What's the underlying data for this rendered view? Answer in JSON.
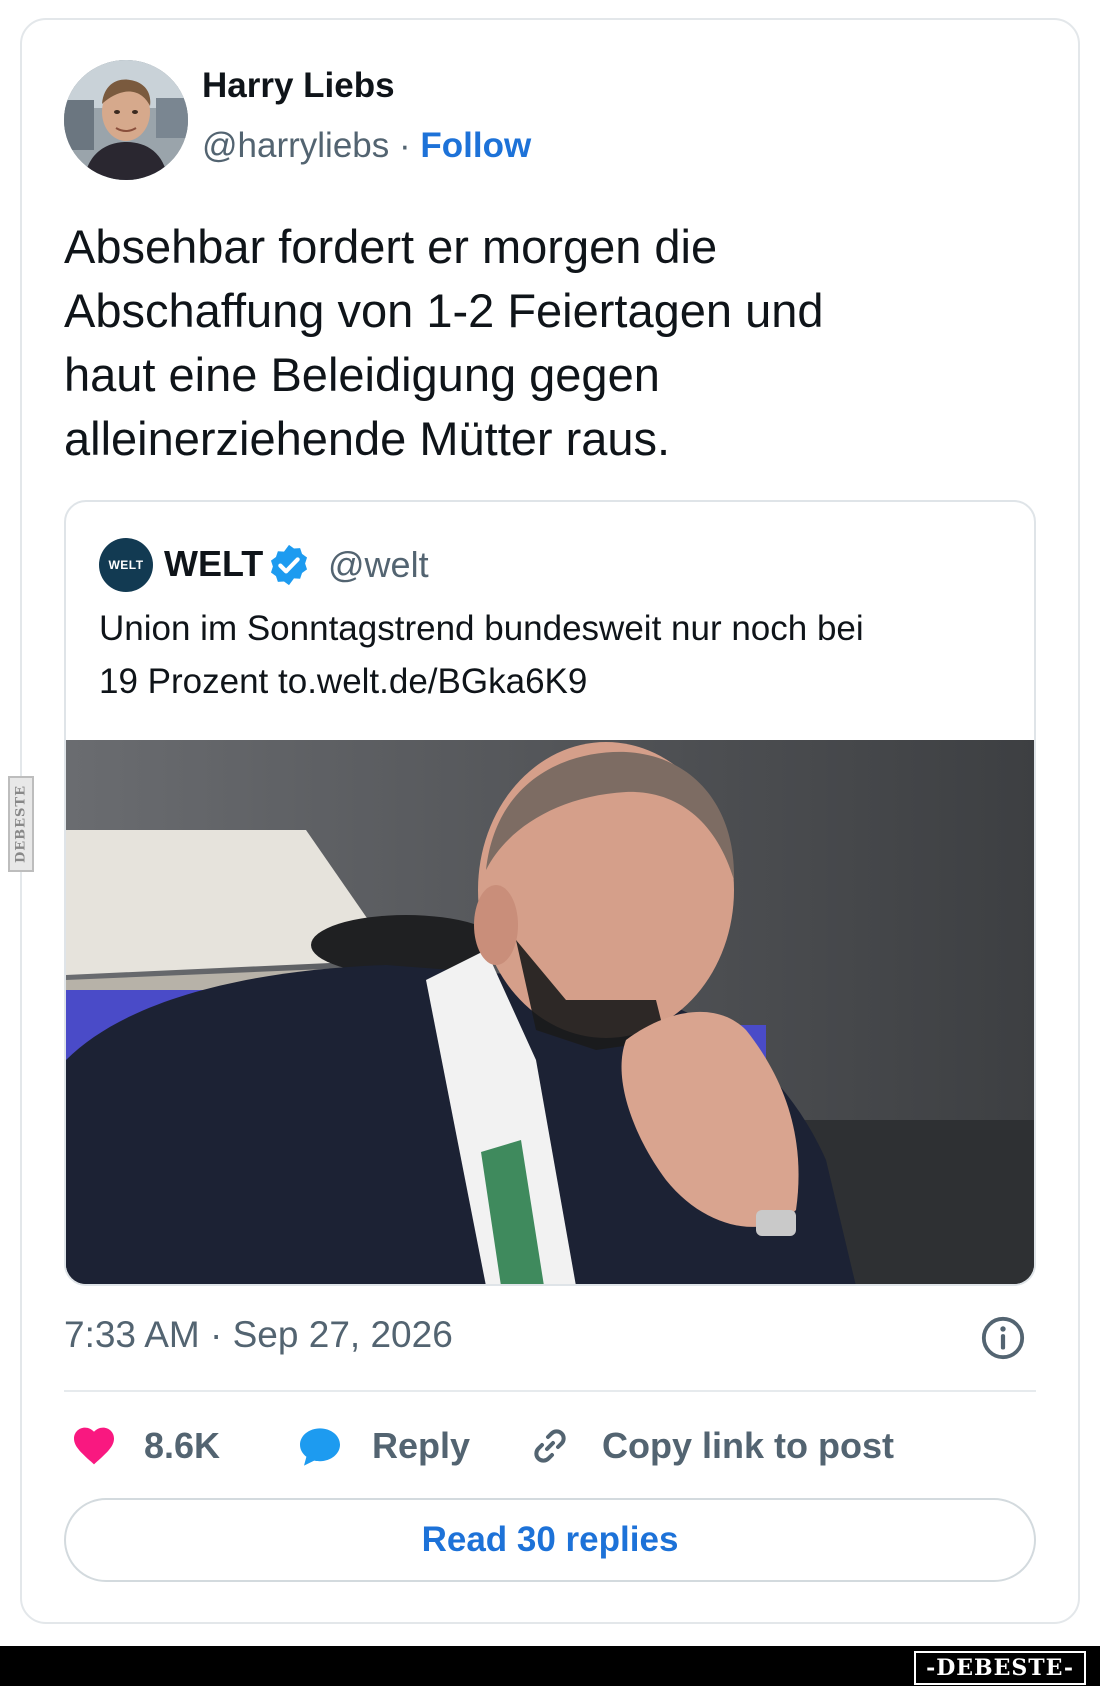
{
  "author": {
    "name": "Harry Liebs",
    "handle": "@harryliebs",
    "separator": " · ",
    "follow_label": "Follow"
  },
  "tweet": {
    "line1": "Absehbar fordert er morgen die",
    "line2": "Abschaffung von 1-2 Feiertagen und",
    "line3": "haut eine Beleidigung gegen",
    "line4": "alleinerziehende Mütter raus."
  },
  "quote": {
    "logo_text": "WELT",
    "name": "WELT",
    "handle": "@welt",
    "line1": "Union im Sonntagstrend bundesweit nur noch bei",
    "line2": "19 Prozent to.welt.de/BGka6K9"
  },
  "timestamp": "7:33 AM · Sep 27, 2026",
  "actions": {
    "likes": "8.6K",
    "reply": "Reply",
    "copy_link": "Copy link to post"
  },
  "read_replies": "Read 30 replies",
  "watermark": {
    "bottom": "-DEBESTE-",
    "side": "DEBESTE"
  },
  "colors": {
    "link": "#1d72d8",
    "heart": "#f91880",
    "reply": "#1d9bf0",
    "verified": "#1d9bf0"
  }
}
